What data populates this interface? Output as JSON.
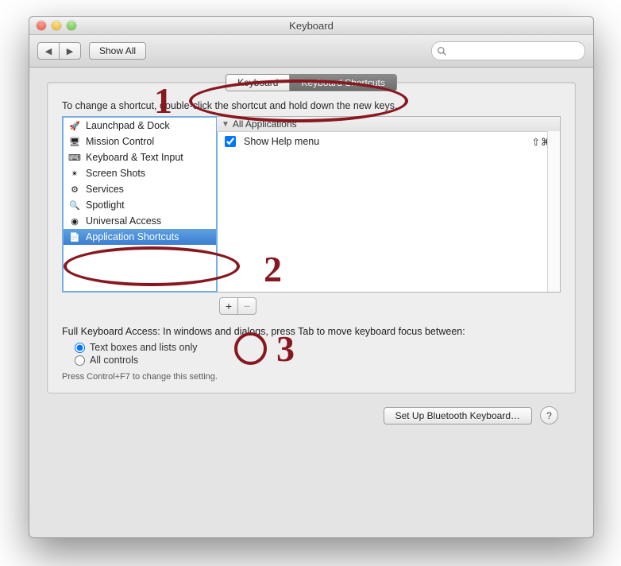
{
  "window": {
    "title": "Keyboard"
  },
  "toolbar": {
    "back": "◀",
    "forward": "▶",
    "show_all": "Show All",
    "search_placeholder": ""
  },
  "tabs": {
    "keyboard": "Keyboard",
    "shortcuts": "Keyboard Shortcuts"
  },
  "hint": "To change a shortcut, double-click the shortcut and hold down the new keys.",
  "categories": [
    {
      "icon": "launchpad-icon",
      "label": "Launchpad & Dock"
    },
    {
      "icon": "mission-icon",
      "label": "Mission Control"
    },
    {
      "icon": "kb-text-icon",
      "label": "Keyboard & Text Input"
    },
    {
      "icon": "camera-icon",
      "label": "Screen Shots"
    },
    {
      "icon": "gear-icon",
      "label": "Services"
    },
    {
      "icon": "spotlight-icon",
      "label": "Spotlight"
    },
    {
      "icon": "universal-icon",
      "label": "Universal Access"
    },
    {
      "icon": "app-icon",
      "label": "Application Shortcuts",
      "selected": true
    }
  ],
  "shortcuts": {
    "group": "All Applications",
    "rows": [
      {
        "checked": true,
        "label": "Show Help menu",
        "keys": "⇧⌘/"
      }
    ]
  },
  "buttons": {
    "add": "+",
    "remove": "−"
  },
  "fka": {
    "label": "Full Keyboard Access: In windows and dialogs, press Tab to move keyboard focus between:",
    "opt1": "Text boxes and lists only",
    "opt2": "All controls",
    "note": "Press Control+F7 to change this setting."
  },
  "footer": {
    "bluetooth": "Set Up Bluetooth Keyboard…",
    "help": "?"
  },
  "annotations": {
    "one": "1",
    "two": "2",
    "three": "3"
  }
}
